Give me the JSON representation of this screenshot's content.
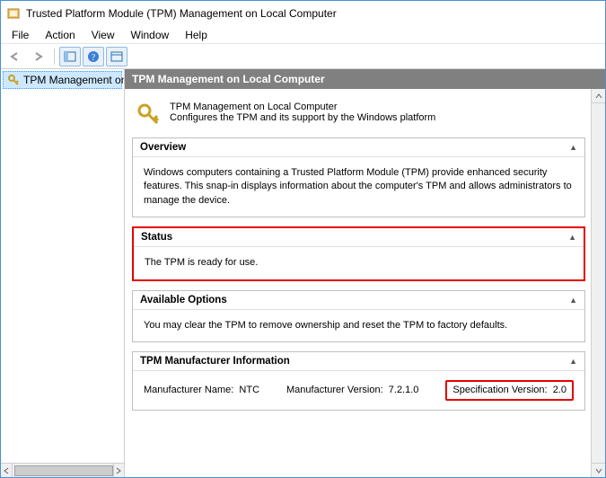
{
  "window": {
    "title": "Trusted Platform Module (TPM) Management on Local Computer"
  },
  "menu": {
    "file": "File",
    "action": "Action",
    "view": "View",
    "window": "Window",
    "help": "Help"
  },
  "tree": {
    "selected": "TPM Management on Local Computer"
  },
  "pane": {
    "header": "TPM Management on Local Computer",
    "intro_line1": "TPM Management on Local Computer",
    "intro_line2": "Configures the TPM and its support by the Windows platform"
  },
  "sections": {
    "overview": {
      "title": "Overview",
      "body": "Windows computers containing a Trusted Platform Module (TPM) provide enhanced security features. This snap-in displays information about the computer's TPM and allows administrators to manage the device."
    },
    "status": {
      "title": "Status",
      "body": "The TPM is ready for use."
    },
    "options": {
      "title": "Available Options",
      "body": "You may clear the TPM to remove ownership and reset the TPM to factory defaults."
    },
    "mfr": {
      "title": "TPM Manufacturer Information",
      "name_label": "Manufacturer Name:",
      "name_value": "NTC",
      "ver_label": "Manufacturer Version:",
      "ver_value": "7.2.1.0",
      "spec_label": "Specification Version:",
      "spec_value": "2.0"
    }
  }
}
